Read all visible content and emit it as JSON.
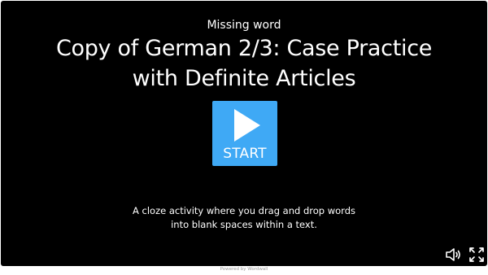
{
  "activity": {
    "type_label": "Missing word",
    "title": "Copy of German 2/3: Case Practice with Definite Articles",
    "start_label": "START",
    "description": "A cloze activity where you drag and drop words into blank spaces within a text."
  },
  "controls": {
    "audio_icon": "speaker-icon",
    "fullscreen_icon": "fullscreen-icon"
  },
  "footer": {
    "text": "Powered by Wordwall"
  },
  "colors": {
    "stage_background": "#000000",
    "start_button": "#3fa9f5",
    "text": "#ffffff"
  }
}
